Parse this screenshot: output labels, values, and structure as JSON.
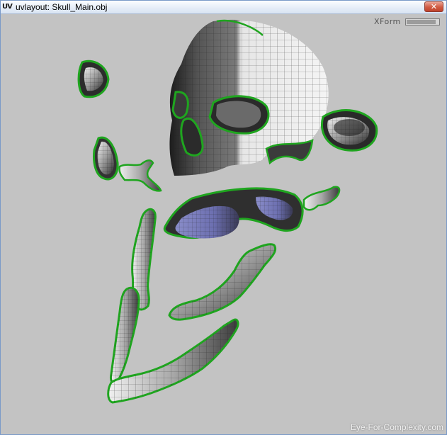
{
  "window": {
    "app_icon": "uvlayout-icon",
    "title": "uvlayout: Skull_Main.obj",
    "close_glyph": "✕"
  },
  "toolbar": {
    "xform_label": "XForm",
    "xform_level": 0.9
  },
  "watermark": "Eye-For-Complexity.com",
  "colors": {
    "viewport_bg": "#c3c3c3",
    "shell_outline": "#1fa51f",
    "mesh_light": "#ececec",
    "mesh_dark": "#2b2b2b",
    "mesh_flipped": "#7d7fbf"
  },
  "meshes": [
    "skull-cranium-shell",
    "left-ear-shell",
    "right-eye-socket-shell",
    "left-cheek-shell",
    "nasal-bone-shell",
    "upper-palate-shell",
    "small-fragment-shell",
    "left-jaw-strip-shell",
    "right-jaw-strip-shell",
    "lower-jaw-shell"
  ]
}
